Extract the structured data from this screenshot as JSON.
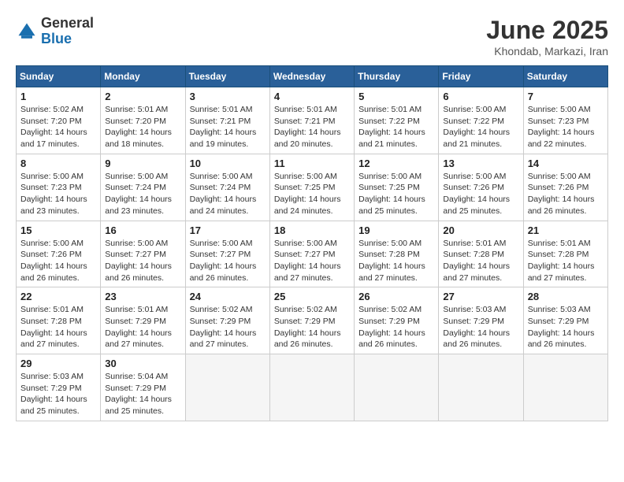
{
  "header": {
    "logo_general": "General",
    "logo_blue": "Blue",
    "month_year": "June 2025",
    "location": "Khondab, Markazi, Iran"
  },
  "calendar": {
    "days_of_week": [
      "Sunday",
      "Monday",
      "Tuesday",
      "Wednesday",
      "Thursday",
      "Friday",
      "Saturday"
    ],
    "weeks": [
      [
        {
          "day": null
        },
        {
          "day": 2,
          "sunrise": "5:01 AM",
          "sunset": "7:20 PM",
          "daylight": "14 hours and 18 minutes."
        },
        {
          "day": 3,
          "sunrise": "5:01 AM",
          "sunset": "7:21 PM",
          "daylight": "14 hours and 19 minutes."
        },
        {
          "day": 4,
          "sunrise": "5:01 AM",
          "sunset": "7:21 PM",
          "daylight": "14 hours and 20 minutes."
        },
        {
          "day": 5,
          "sunrise": "5:01 AM",
          "sunset": "7:22 PM",
          "daylight": "14 hours and 21 minutes."
        },
        {
          "day": 6,
          "sunrise": "5:00 AM",
          "sunset": "7:22 PM",
          "daylight": "14 hours and 21 minutes."
        },
        {
          "day": 7,
          "sunrise": "5:00 AM",
          "sunset": "7:23 PM",
          "daylight": "14 hours and 22 minutes."
        }
      ],
      [
        {
          "day": 1,
          "sunrise": "5:02 AM",
          "sunset": "7:20 PM",
          "daylight": "14 hours and 17 minutes."
        },
        {
          "day": 2,
          "sunrise": "5:01 AM",
          "sunset": "7:20 PM",
          "daylight": "14 hours and 18 minutes."
        },
        {
          "day": 3,
          "sunrise": "5:01 AM",
          "sunset": "7:21 PM",
          "daylight": "14 hours and 19 minutes."
        },
        {
          "day": 4,
          "sunrise": "5:01 AM",
          "sunset": "7:21 PM",
          "daylight": "14 hours and 20 minutes."
        },
        {
          "day": 5,
          "sunrise": "5:01 AM",
          "sunset": "7:22 PM",
          "daylight": "14 hours and 21 minutes."
        },
        {
          "day": 6,
          "sunrise": "5:00 AM",
          "sunset": "7:22 PM",
          "daylight": "14 hours and 21 minutes."
        },
        {
          "day": 7,
          "sunrise": "5:00 AM",
          "sunset": "7:23 PM",
          "daylight": "14 hours and 22 minutes."
        }
      ],
      [
        {
          "day": 8,
          "sunrise": "5:00 AM",
          "sunset": "7:23 PM",
          "daylight": "14 hours and 23 minutes."
        },
        {
          "day": 9,
          "sunrise": "5:00 AM",
          "sunset": "7:24 PM",
          "daylight": "14 hours and 23 minutes."
        },
        {
          "day": 10,
          "sunrise": "5:00 AM",
          "sunset": "7:24 PM",
          "daylight": "14 hours and 24 minutes."
        },
        {
          "day": 11,
          "sunrise": "5:00 AM",
          "sunset": "7:25 PM",
          "daylight": "14 hours and 24 minutes."
        },
        {
          "day": 12,
          "sunrise": "5:00 AM",
          "sunset": "7:25 PM",
          "daylight": "14 hours and 25 minutes."
        },
        {
          "day": 13,
          "sunrise": "5:00 AM",
          "sunset": "7:26 PM",
          "daylight": "14 hours and 25 minutes."
        },
        {
          "day": 14,
          "sunrise": "5:00 AM",
          "sunset": "7:26 PM",
          "daylight": "14 hours and 26 minutes."
        }
      ],
      [
        {
          "day": 15,
          "sunrise": "5:00 AM",
          "sunset": "7:26 PM",
          "daylight": "14 hours and 26 minutes."
        },
        {
          "day": 16,
          "sunrise": "5:00 AM",
          "sunset": "7:27 PM",
          "daylight": "14 hours and 26 minutes."
        },
        {
          "day": 17,
          "sunrise": "5:00 AM",
          "sunset": "7:27 PM",
          "daylight": "14 hours and 26 minutes."
        },
        {
          "day": 18,
          "sunrise": "5:00 AM",
          "sunset": "7:27 PM",
          "daylight": "14 hours and 27 minutes."
        },
        {
          "day": 19,
          "sunrise": "5:00 AM",
          "sunset": "7:28 PM",
          "daylight": "14 hours and 27 minutes."
        },
        {
          "day": 20,
          "sunrise": "5:01 AM",
          "sunset": "7:28 PM",
          "daylight": "14 hours and 27 minutes."
        },
        {
          "day": 21,
          "sunrise": "5:01 AM",
          "sunset": "7:28 PM",
          "daylight": "14 hours and 27 minutes."
        }
      ],
      [
        {
          "day": 22,
          "sunrise": "5:01 AM",
          "sunset": "7:28 PM",
          "daylight": "14 hours and 27 minutes."
        },
        {
          "day": 23,
          "sunrise": "5:01 AM",
          "sunset": "7:29 PM",
          "daylight": "14 hours and 27 minutes."
        },
        {
          "day": 24,
          "sunrise": "5:02 AM",
          "sunset": "7:29 PM",
          "daylight": "14 hours and 27 minutes."
        },
        {
          "day": 25,
          "sunrise": "5:02 AM",
          "sunset": "7:29 PM",
          "daylight": "14 hours and 26 minutes."
        },
        {
          "day": 26,
          "sunrise": "5:02 AM",
          "sunset": "7:29 PM",
          "daylight": "14 hours and 26 minutes."
        },
        {
          "day": 27,
          "sunrise": "5:03 AM",
          "sunset": "7:29 PM",
          "daylight": "14 hours and 26 minutes."
        },
        {
          "day": 28,
          "sunrise": "5:03 AM",
          "sunset": "7:29 PM",
          "daylight": "14 hours and 26 minutes."
        }
      ],
      [
        {
          "day": 29,
          "sunrise": "5:03 AM",
          "sunset": "7:29 PM",
          "daylight": "14 hours and 25 minutes."
        },
        {
          "day": 30,
          "sunrise": "5:04 AM",
          "sunset": "7:29 PM",
          "daylight": "14 hours and 25 minutes."
        },
        {
          "day": null
        },
        {
          "day": null
        },
        {
          "day": null
        },
        {
          "day": null
        },
        {
          "day": null
        }
      ]
    ],
    "week1": [
      {
        "day": 1,
        "sunrise": "5:02 AM",
        "sunset": "7:20 PM",
        "daylight": "14 hours and 17 minutes."
      },
      {
        "day": 2,
        "sunrise": "5:01 AM",
        "sunset": "7:20 PM",
        "daylight": "14 hours and 18 minutes."
      },
      {
        "day": 3,
        "sunrise": "5:01 AM",
        "sunset": "7:21 PM",
        "daylight": "14 hours and 19 minutes."
      },
      {
        "day": 4,
        "sunrise": "5:01 AM",
        "sunset": "7:21 PM",
        "daylight": "14 hours and 20 minutes."
      },
      {
        "day": 5,
        "sunrise": "5:01 AM",
        "sunset": "7:22 PM",
        "daylight": "14 hours and 21 minutes."
      },
      {
        "day": 6,
        "sunrise": "5:00 AM",
        "sunset": "7:22 PM",
        "daylight": "14 hours and 21 minutes."
      },
      {
        "day": 7,
        "sunrise": "5:00 AM",
        "sunset": "7:23 PM",
        "daylight": "14 hours and 22 minutes."
      }
    ]
  },
  "labels": {
    "sunrise": "Sunrise:",
    "sunset": "Sunset:",
    "daylight": "Daylight:"
  }
}
